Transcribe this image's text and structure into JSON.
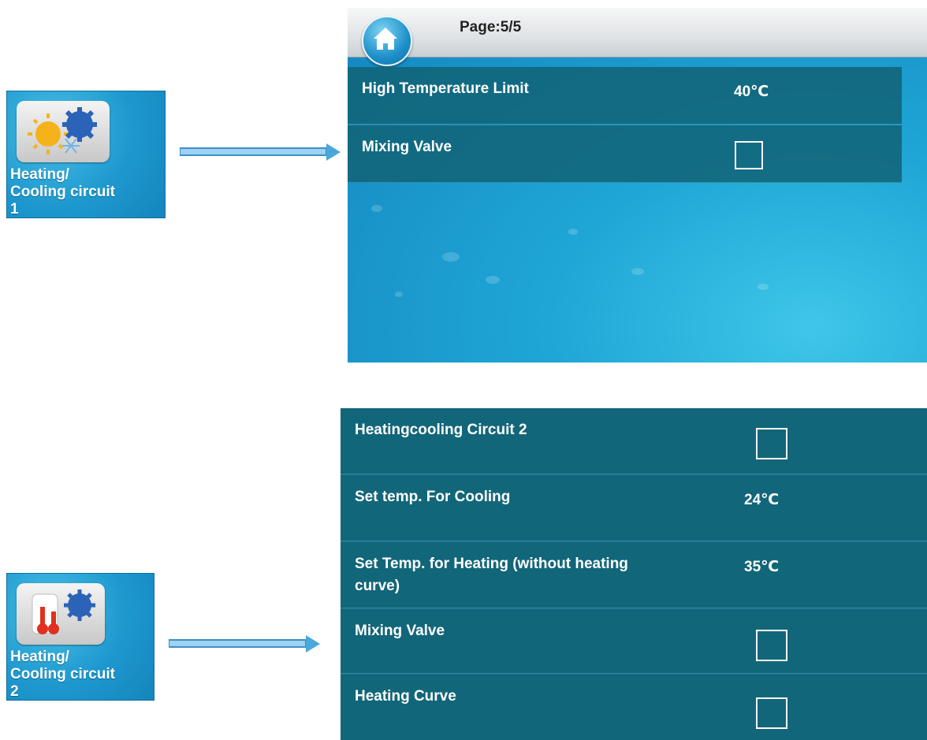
{
  "tile1": {
    "label_line1": "Heating/",
    "label_line2": "Cooling circuit",
    "label_line3": "1",
    "icon": "sun-snowflake-gear-icon"
  },
  "tile2": {
    "label_line1": "Heating/",
    "label_line2": "Cooling circuit",
    "label_line3": "2",
    "icon": "thermometer-gear-icon"
  },
  "screen1": {
    "page_label": "Page:5/5",
    "home_icon": "home-icon",
    "rows": [
      {
        "label": "High Temperature Limit",
        "value": "40℃"
      },
      {
        "label": "Mixing Valve",
        "checked": false
      }
    ]
  },
  "screen2": {
    "rows": [
      {
        "label": "Heatingcooling Circuit 2",
        "checked": false
      },
      {
        "label": "Set temp. For Cooling",
        "value": "24℃"
      },
      {
        "label_line1": "Set Temp. for Heating (without heating",
        "label_line2": "curve)",
        "value": "35℃"
      },
      {
        "label": "Mixing Valve",
        "checked": false
      },
      {
        "label": "Heating Curve",
        "checked": false
      }
    ]
  },
  "colors": {
    "row_bg": "#116478",
    "screen_bg": "#1fa6d6",
    "arrow": "#4aa7dc"
  }
}
